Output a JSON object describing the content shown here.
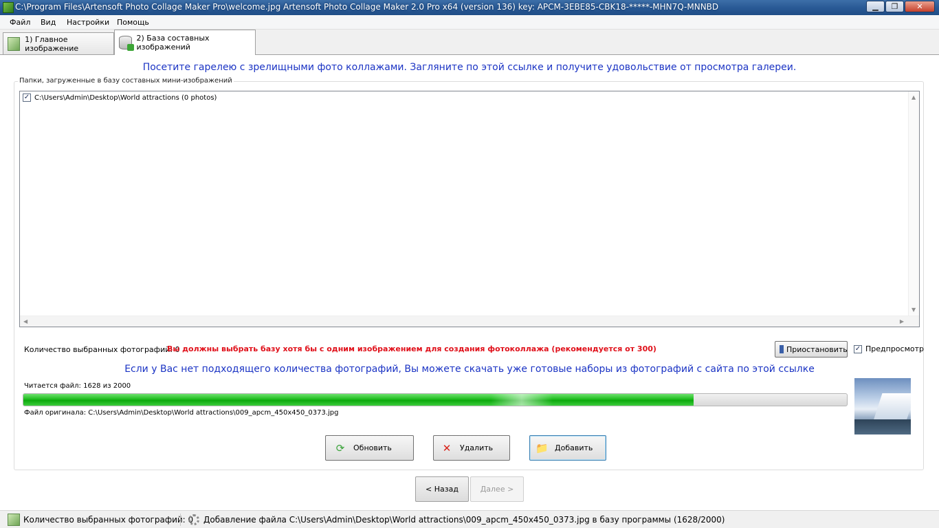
{
  "window": {
    "title": "C:\\Program Files\\Artensoft Photo Collage Maker Pro\\welcome.jpg Artensoft Photo Collage Maker  2.0 Pro x64 (version 136) key: APCM-3EBE85-CBK18-*****-MHN7Q-MNNBD",
    "minimize": "▁",
    "maximize": "❐",
    "close": "✕"
  },
  "menu": [
    "Файл",
    "Вид",
    "Настройки",
    "Помощь"
  ],
  "tabs": [
    {
      "label": "1) Главное изображение",
      "icon": "image-icon",
      "active": false
    },
    {
      "label": "2) База составных изображений",
      "icon": "database-add-icon",
      "active": true
    }
  ],
  "gallery_link": "Посетите гарелею с зрелищными фото коллажами. Загляните по этой ссылке и получите удовольствие от просмотра галереи.",
  "folders_group": {
    "title": "Папки, загруженные в базу составных мини-изображений",
    "items": [
      {
        "path": "C:\\Users\\Admin\\Desktop\\World attractions (0 photos)",
        "checked": true
      }
    ]
  },
  "selection": {
    "count_label": "Количество выбранных фотографий: 0",
    "warning": "Вы должны выбрать базу хотя бы с одним изображением для создания фотоколлажа (рекомендуется от 300)",
    "warning_color": "#e0101a",
    "pause_label": "Приостановить",
    "preview_label": "Предпросмотр",
    "preview_checked": true
  },
  "download_link": "Если у Вас нет подходящего количества фотографий, Вы можете скачать уже готовые наборы из фотографий с сайта по этой ссылке",
  "loading": {
    "reading_label": "Читается файл: 1628  из  2000",
    "progress_current": 1628,
    "progress_total": 2000,
    "original_file_label": "Файл оригинала:  C:\\Users\\Admin\\Desktop\\World attractions\\009_apcm_450x450_0373.jpg"
  },
  "buttons": {
    "refresh": "Обновить",
    "delete": "Удалить",
    "add": "Добавить"
  },
  "nav": {
    "back": "< Назад",
    "next": "Далее >"
  },
  "statusbar": {
    "count": "Количество выбранных фотографий: 0",
    "message": "Добавление файла C:\\Users\\Admin\\Desktop\\World attractions\\009_apcm_450x450_0373.jpg в базу программы (1628/2000)"
  },
  "colors": {
    "link": "#1a33c4",
    "progress": "#1fbc1f",
    "titlebar": "#2a5a96"
  }
}
